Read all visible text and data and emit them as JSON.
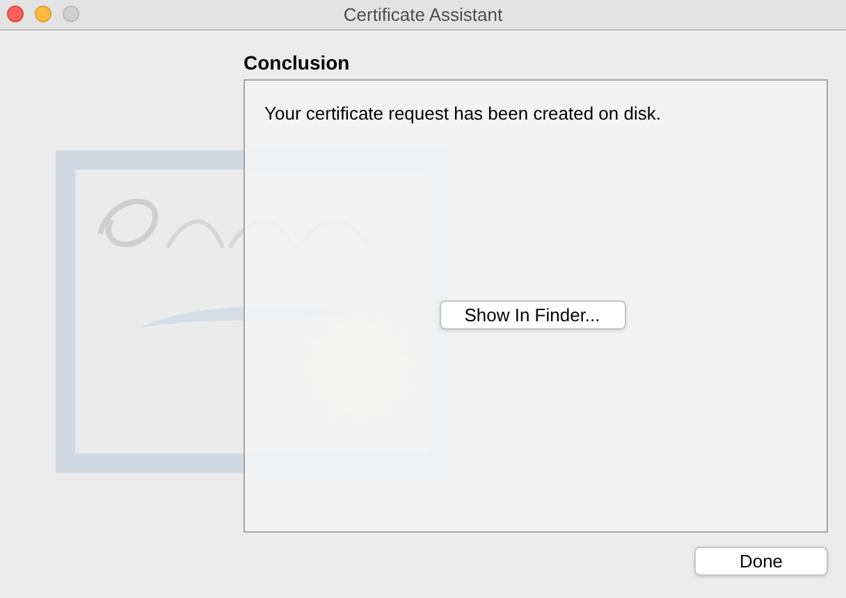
{
  "window": {
    "title": "Certificate Assistant"
  },
  "heading": "Conclusion",
  "message": "Your certificate request has been created on disk.",
  "buttons": [
    {
      "label": "Show In Finder...",
      "kind": "inline"
    },
    {
      "label": "Done",
      "kind": "footer"
    }
  ]
}
